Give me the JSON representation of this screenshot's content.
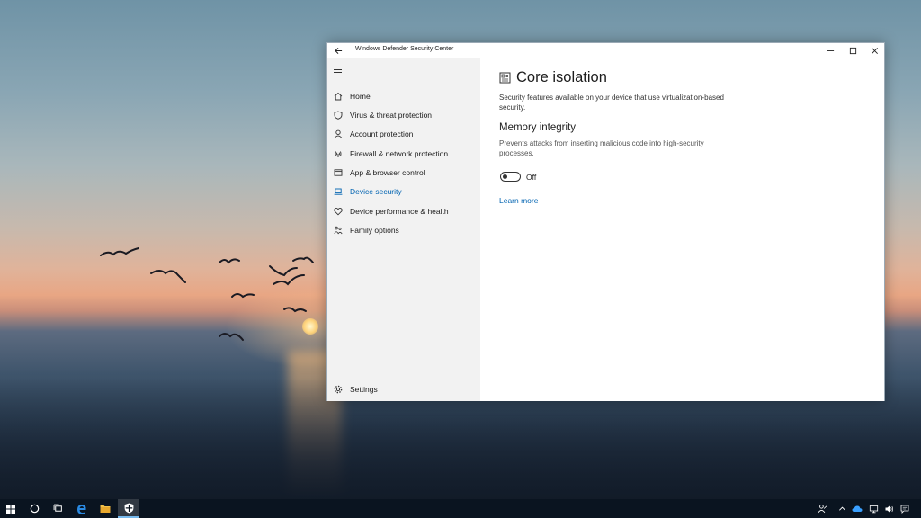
{
  "window": {
    "title": "Windows Defender Security Center"
  },
  "sidebar": {
    "items": [
      {
        "label": "Home",
        "icon": "home-icon"
      },
      {
        "label": "Virus & threat protection",
        "icon": "shield-icon"
      },
      {
        "label": "Account protection",
        "icon": "person-icon"
      },
      {
        "label": "Firewall & network protection",
        "icon": "wifi-icon"
      },
      {
        "label": "App & browser control",
        "icon": "app-window-icon"
      },
      {
        "label": "Device security",
        "icon": "laptop-icon",
        "active": true
      },
      {
        "label": "Device performance & health",
        "icon": "heart-icon"
      },
      {
        "label": "Family options",
        "icon": "family-icon"
      }
    ],
    "settings_label": "Settings"
  },
  "main": {
    "title": "Core isolation",
    "description": "Security features available on your device that use virtualization-based security.",
    "memory_integrity": {
      "title": "Memory integrity",
      "description": "Prevents attacks from inserting malicious code into high-security processes.",
      "toggle_state": "Off"
    },
    "learn_more": "Learn more"
  },
  "colors": {
    "accent": "#0063b1",
    "sidebar_bg": "#f2f2f2",
    "taskbar_bg": "#0a1420"
  }
}
